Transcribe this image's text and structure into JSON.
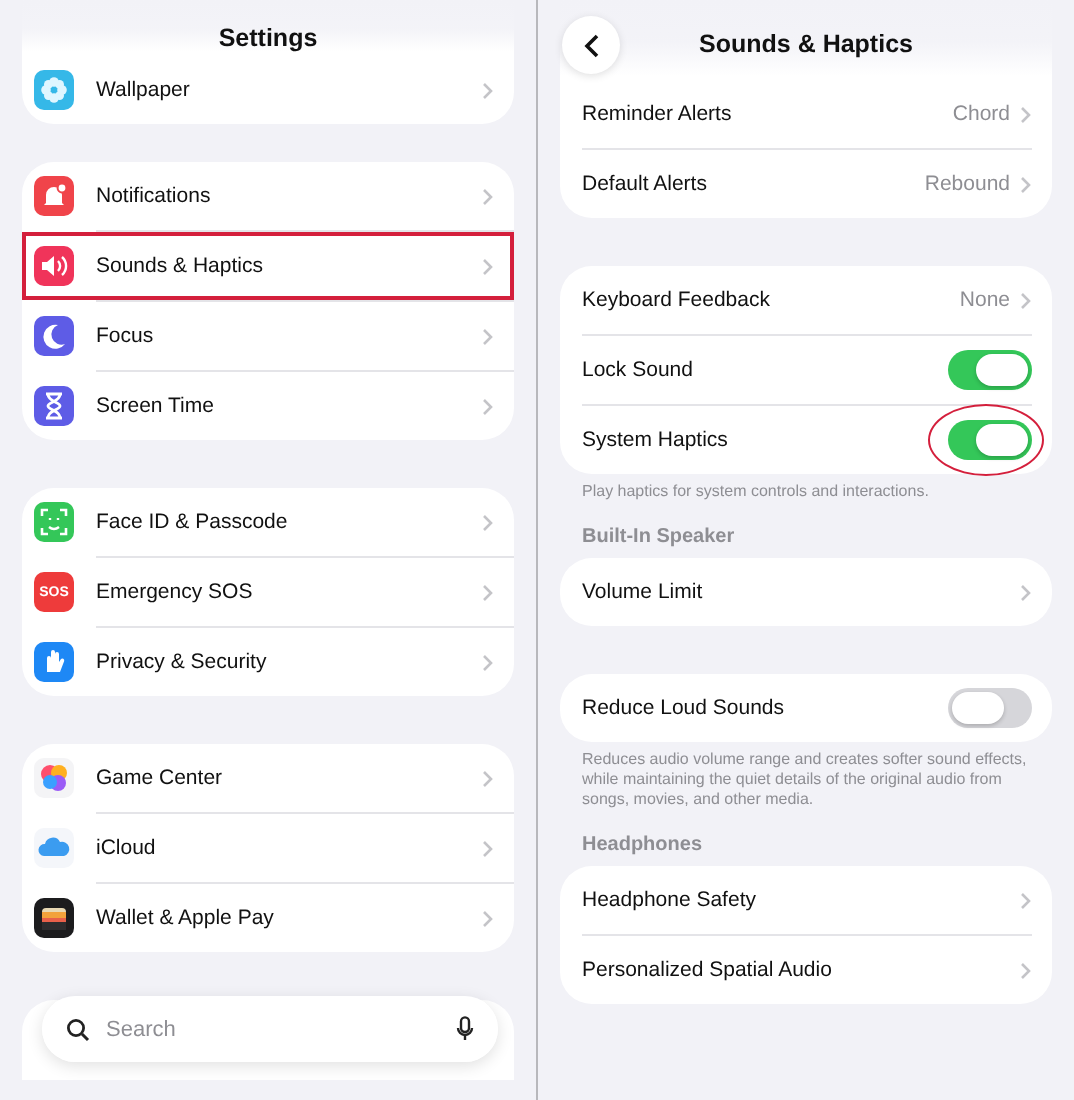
{
  "settings": {
    "title": "Settings",
    "groups": [
      {
        "items": [
          {
            "label": "Wallpaper",
            "highlighted": false
          }
        ]
      },
      {
        "items": [
          {
            "label": "Notifications",
            "highlighted": false
          },
          {
            "label": "Sounds & Haptics",
            "highlighted": true
          },
          {
            "label": "Focus",
            "highlighted": false
          },
          {
            "label": "Screen Time",
            "highlighted": false
          }
        ]
      },
      {
        "items": [
          {
            "label": "Face ID & Passcode",
            "highlighted": false
          },
          {
            "label": "Emergency SOS",
            "icon_text": "SOS",
            "highlighted": false
          },
          {
            "label": "Privacy & Security",
            "highlighted": false
          }
        ]
      },
      {
        "items": [
          {
            "label": "Game Center",
            "highlighted": false
          },
          {
            "label": "iCloud",
            "highlighted": false
          },
          {
            "label": "Wallet & Apple Pay",
            "highlighted": false
          }
        ]
      }
    ],
    "search": {
      "placeholder": "Search"
    }
  },
  "sounds": {
    "title": "Sounds & Haptics",
    "sections": [
      {
        "items": [
          {
            "kind": "link",
            "label": "Reminder Alerts",
            "value": "Chord"
          },
          {
            "kind": "link",
            "label": "Default Alerts",
            "value": "Rebound"
          }
        ]
      },
      {
        "items": [
          {
            "kind": "link",
            "label": "Keyboard Feedback",
            "value": "None"
          },
          {
            "kind": "toggle",
            "label": "Lock Sound",
            "on": true,
            "circled": false
          },
          {
            "kind": "toggle",
            "label": "System Haptics",
            "on": true,
            "circled": true
          }
        ],
        "footer": "Play haptics for system controls and interactions."
      },
      {
        "header": "Built-In Speaker",
        "items": [
          {
            "kind": "link",
            "label": "Volume Limit"
          }
        ]
      },
      {
        "items": [
          {
            "kind": "toggle",
            "label": "Reduce Loud Sounds",
            "on": false,
            "circled": false
          }
        ],
        "footer": "Reduces audio volume range and creates softer sound effects, while maintaining the quiet details of the original audio from songs, movies, and other media."
      },
      {
        "header": "Headphones",
        "items": [
          {
            "kind": "link",
            "label": "Headphone Safety"
          },
          {
            "kind": "link",
            "label": "Personalized Spatial Audio"
          }
        ]
      }
    ]
  }
}
